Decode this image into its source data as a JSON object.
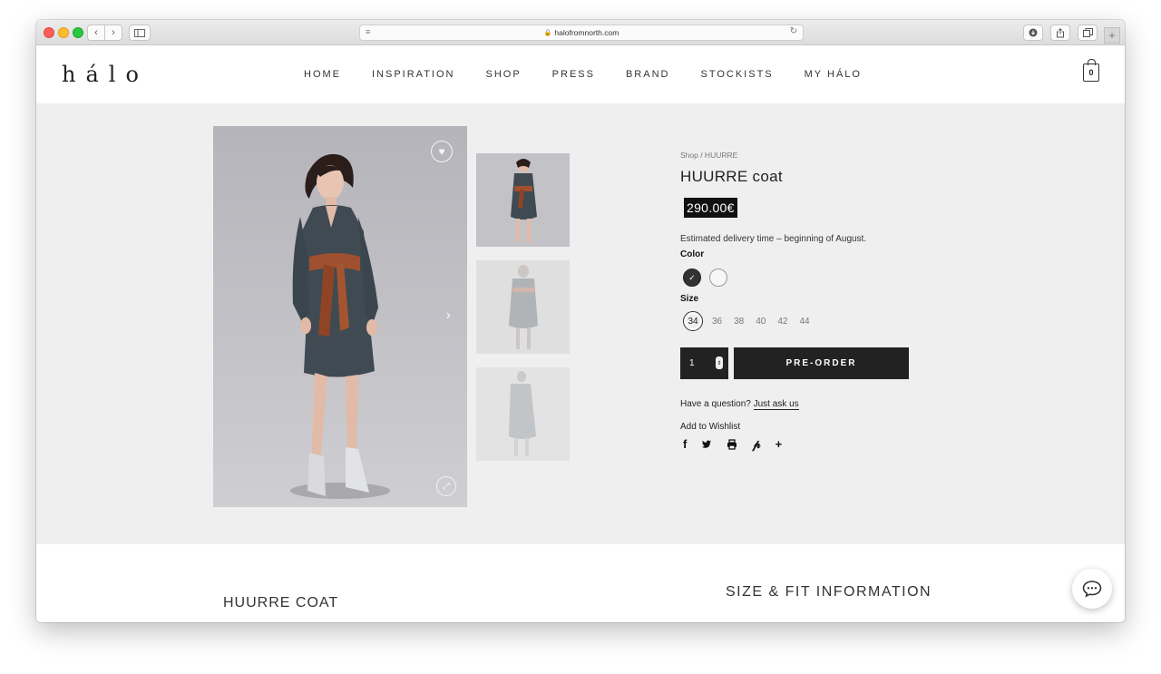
{
  "browser": {
    "url": "halofromnorth.com",
    "back_label": "‹",
    "forward_label": "›"
  },
  "site": {
    "logo": "hálo",
    "nav": [
      "HOME",
      "INSPIRATION",
      "SHOP",
      "PRESS",
      "BRAND",
      "STOCKISTS",
      "MY HÁLO"
    ],
    "cart_count": "0"
  },
  "product": {
    "breadcrumb": "Shop / HUURRE",
    "title": "HUURRE coat",
    "price": "290.00€",
    "delivery": "Estimated delivery time – beginning of August.",
    "color_label": "Color",
    "size_label": "Size",
    "sizes": [
      "34",
      "36",
      "38",
      "40",
      "42",
      "44"
    ],
    "quantity": "1",
    "preorder_label": "PRE-ORDER",
    "question_text": "Have a question?",
    "ask_link": "Just ask us",
    "wishlist_label": "Add to Wishlist"
  },
  "below": {
    "description_title": "HUURRE COAT",
    "fit_title": "SIZE & FIT INFORMATION"
  },
  "colors": {
    "background": "#efefef",
    "button": "#222222",
    "price_bg": "#111111"
  }
}
